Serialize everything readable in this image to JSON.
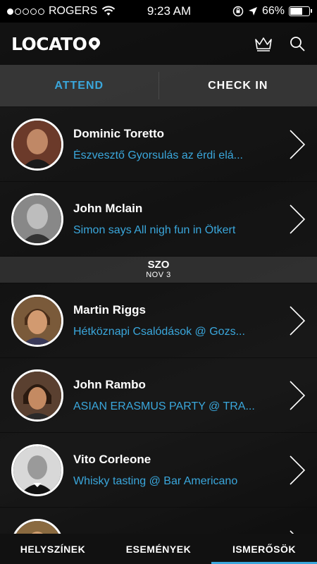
{
  "status_bar": {
    "carrier": "ROGERS",
    "time": "9:23 AM",
    "battery": "66%",
    "battery_level": 0.66,
    "signal_bars_filled": 1,
    "signal_bars_total": 5
  },
  "header": {
    "logo": "LOCATO",
    "icons": [
      "crown-icon",
      "search-icon"
    ]
  },
  "tabs": [
    {
      "label": "ATTEND",
      "active": true
    },
    {
      "label": "CHECK IN",
      "active": false
    }
  ],
  "list": {
    "group1": [
      {
        "name": "Dominic Toretto",
        "event": "Észvesztő Gyorsulás az érdi elá..."
      },
      {
        "name": "John Mclain",
        "event": "Simon says All nigh fun in Ötkert"
      }
    ],
    "separator": {
      "day": "SZO",
      "month": "NOV 3"
    },
    "group2": [
      {
        "name": "Martin Riggs",
        "event": "Hétköznapi Csalódások @ Gozs..."
      },
      {
        "name": "John Rambo",
        "event": "ASIAN ERASMUS PARTY @  TRA..."
      },
      {
        "name": "Vito Corleone",
        "event": "Whisky tasting @ Bar Americano"
      },
      {
        "name": "",
        "event": ""
      }
    ]
  },
  "bottom_nav": [
    {
      "label": "HELYSZÍNEK",
      "active": false
    },
    {
      "label": "ESEMÉNYEK",
      "active": false
    },
    {
      "label": "ISMERŐSÖK",
      "active": true
    }
  ],
  "colors": {
    "accent": "#3aa7dc",
    "background": "#1b1b1b",
    "text": "#ffffff"
  }
}
